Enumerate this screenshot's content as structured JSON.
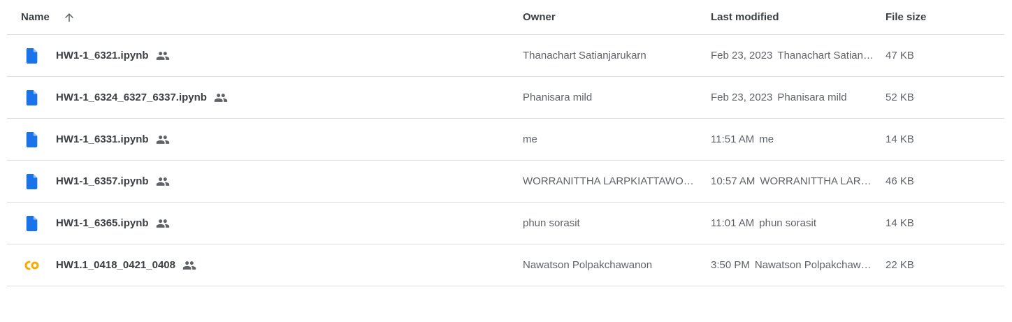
{
  "header": {
    "name": "Name",
    "owner": "Owner",
    "last_modified": "Last modified",
    "file_size": "File size"
  },
  "files": [
    {
      "name": "HW1-1_6321.ipynb",
      "icon": "doc-icon",
      "shared": true,
      "owner": "Thanachart Satianjarukarn",
      "modified_date": "Feb 23, 2023",
      "modified_by": "Thanachart Satianjarukarn",
      "size": "47 KB"
    },
    {
      "name": "HW1-1_6324_6327_6337.ipynb",
      "icon": "doc-icon",
      "shared": true,
      "owner": "Phanisara mild",
      "modified_date": "Feb 23, 2023",
      "modified_by": "Phanisara mild",
      "size": "52 KB"
    },
    {
      "name": "HW1-1_6331.ipynb",
      "icon": "doc-icon",
      "shared": true,
      "owner": "me",
      "modified_date": "11:51 AM",
      "modified_by": "me",
      "size": "14 KB"
    },
    {
      "name": "HW1-1_6357.ipynb",
      "icon": "doc-icon",
      "shared": true,
      "owner": "WORRANITTHA LARPKIATTAWONG",
      "modified_date": "10:57 AM",
      "modified_by": "WORRANITTHA LARPKIATTAWONG",
      "size": "46 KB"
    },
    {
      "name": "HW1-1_6365.ipynb",
      "icon": "doc-icon",
      "shared": true,
      "owner": "phun sorasit",
      "modified_date": "11:01 AM",
      "modified_by": "phun sorasit",
      "size": "14 KB"
    },
    {
      "name": "HW1.1_0418_0421_0408",
      "icon": "colab-icon",
      "shared": true,
      "owner": "Nawatson Polpakchawanon",
      "modified_date": "3:50 PM",
      "modified_by": "Nawatson Polpakchawanon",
      "size": "22 KB"
    }
  ],
  "colors": {
    "doc_icon": "#1a73e8",
    "colab_icon": "#f9ab00",
    "divider": "#dadce0",
    "muted_text": "#5f6368"
  }
}
